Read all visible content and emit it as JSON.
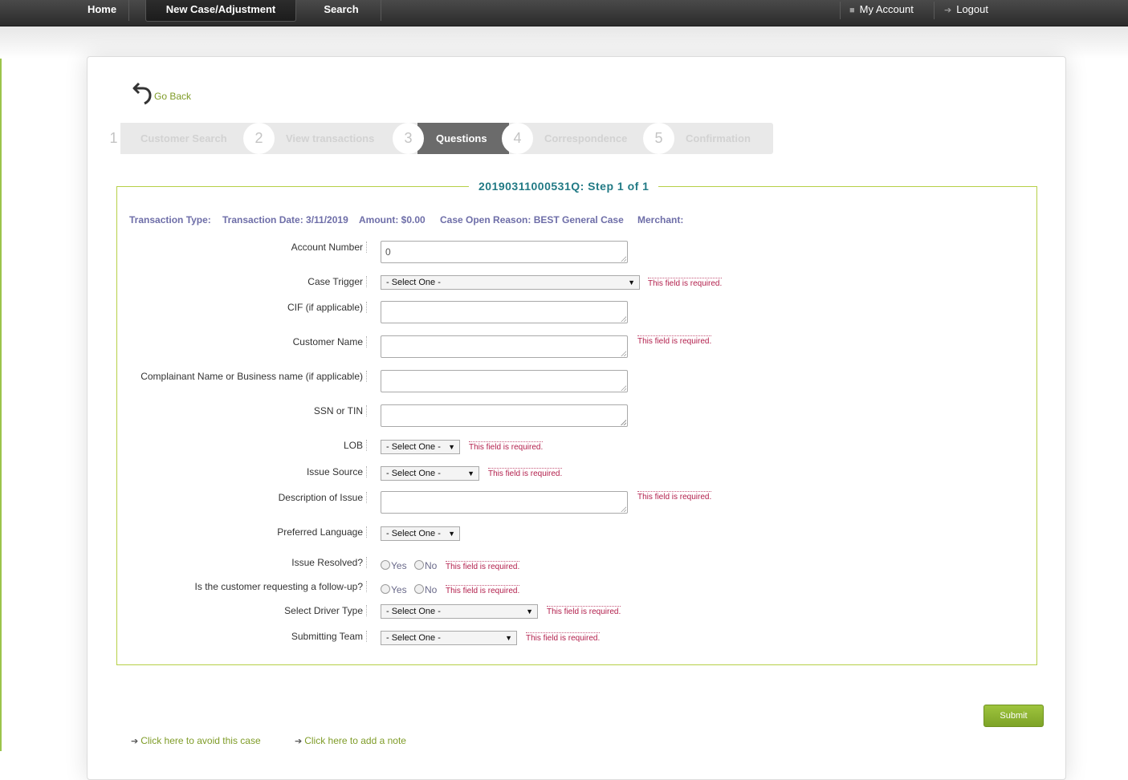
{
  "nav": {
    "home": "Home",
    "new_case": "New Case/Adjustment",
    "search": "Search",
    "my_account": "My Account",
    "logout": "Logout"
  },
  "go_back": "Go Back",
  "steps": [
    {
      "num": "1",
      "label": "Customer Search"
    },
    {
      "num": "2",
      "label": "View transactions"
    },
    {
      "num": "3",
      "label": "Questions"
    },
    {
      "num": "4",
      "label": "Correspondence"
    },
    {
      "num": "5",
      "label": "Confirmation"
    }
  ],
  "form_title": "20190311000531Q: Step 1 of 1",
  "meta": {
    "transaction_type": "Transaction Type:",
    "transaction_date": "Transaction Date: 3/11/2019",
    "amount": "Amount: $0.00",
    "case_open_reason": "Case Open Reason: BEST General Case",
    "merchant": "Merchant:"
  },
  "fields": {
    "account_number": {
      "label": "Account Number",
      "value": "0"
    },
    "case_trigger": {
      "label": "Case Trigger",
      "value": "- Select One -"
    },
    "cif": {
      "label": "CIF (if applicable)",
      "value": ""
    },
    "customer_name": {
      "label": "Customer Name",
      "value": ""
    },
    "complainant": {
      "label": "Complainant Name or Business name (if applicable)",
      "value": ""
    },
    "ssn": {
      "label": "SSN or TIN",
      "value": ""
    },
    "lob": {
      "label": "LOB",
      "value": "- Select One -"
    },
    "issue_source": {
      "label": "Issue Source",
      "value": "- Select One -"
    },
    "description": {
      "label": "Description of Issue",
      "value": ""
    },
    "preferred_language": {
      "label": "Preferred Language",
      "value": "- Select One -"
    },
    "issue_resolved": {
      "label": "Issue Resolved?",
      "yes": "Yes",
      "no": "No"
    },
    "follow_up": {
      "label": "Is the customer requesting a follow-up?",
      "yes": "Yes",
      "no": "No"
    },
    "driver_type": {
      "label": "Select Driver Type",
      "value": "- Select One -"
    },
    "submitting_team": {
      "label": "Submitting Team",
      "value": "- Select One -"
    }
  },
  "required_msg": "This field is required.",
  "submit": "Submit",
  "footer": {
    "avoid": "Click here to avoid this case",
    "note": "Click here to add a note"
  }
}
